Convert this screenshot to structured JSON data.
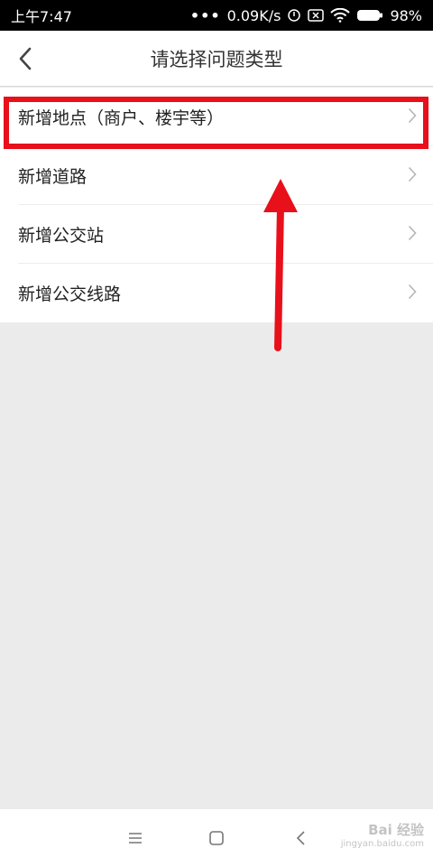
{
  "status_bar": {
    "time": "上午7:47",
    "speed": "0.09K/s",
    "battery": "98%"
  },
  "header": {
    "title": "请选择问题类型"
  },
  "list": {
    "items": [
      {
        "label": "新增地点（商户、楼宇等）"
      },
      {
        "label": "新增道路"
      },
      {
        "label": "新增公交站"
      },
      {
        "label": "新增公交线路"
      }
    ]
  },
  "watermark": {
    "brand": "Bai 经验",
    "url": "jingyan.baidu.com"
  },
  "colors": {
    "highlight": "#e8101a",
    "background": "#ebebeb"
  },
  "icons": {
    "back": "chevron-left-icon",
    "row": "chevron-right-icon",
    "nav_menu": "menu-icon",
    "nav_home": "home-square-icon",
    "nav_back": "back-triangle-icon"
  }
}
